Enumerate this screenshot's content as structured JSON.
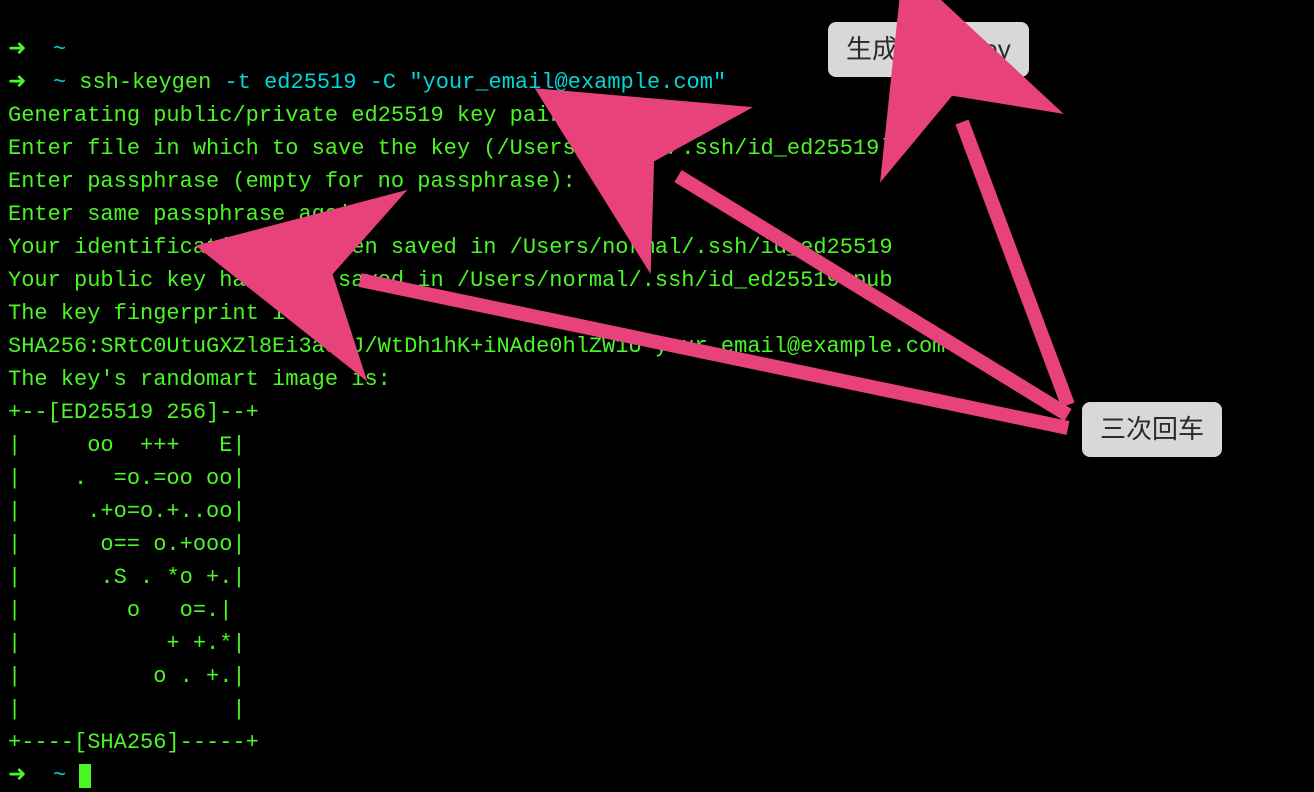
{
  "prompt0": {
    "arrow": "➜",
    "tilde": "~"
  },
  "command": {
    "arrow": "➜",
    "tilde": "~",
    "name": "ssh-keygen",
    "args": " -t ed25519 -C \"your_email@example.com\""
  },
  "output": {
    "l1": "Generating public/private ed25519 key pair.",
    "l2": "Enter file in which to save the key (/Users/normal/.ssh/id_ed25519):",
    "l3": "Enter passphrase (empty for no passphrase):",
    "l4": "Enter same passphrase again:",
    "l5": "Your identification has been saved in /Users/normal/.ssh/id_ed25519",
    "l6": "Your public key has been saved in /Users/normal/.ssh/id_ed25519.pub",
    "l7": "The key fingerprint is:",
    "l8": "SHA256:SRtC0UtuGXZl8Ei3a5xJ/WtDh1hK+iNAde0hlZW1U your_email@example.com",
    "l9": "The key's randomart image is:",
    "ra0": "+--[ED25519 256]--+",
    "ra1": "|     oo  +++   E|",
    "ra2": "|    .  =o.=oo oo|",
    "ra3": "|     .+o=o.+..oo|",
    "ra4": "|      o== o.+ooo|",
    "ra5": "|      .S . *o +.|",
    "ra6": "|        o   o=.|",
    "ra7": "|           + +.*|",
    "ra8": "|          o . +.|",
    "ra9": "|                |",
    "ra10": "+----[SHA256]-----+"
  },
  "prompt2": {
    "arrow": "➜",
    "tilde": "~"
  },
  "callouts": {
    "ssh": "生成 SSH Key",
    "enter": "三次回车"
  }
}
